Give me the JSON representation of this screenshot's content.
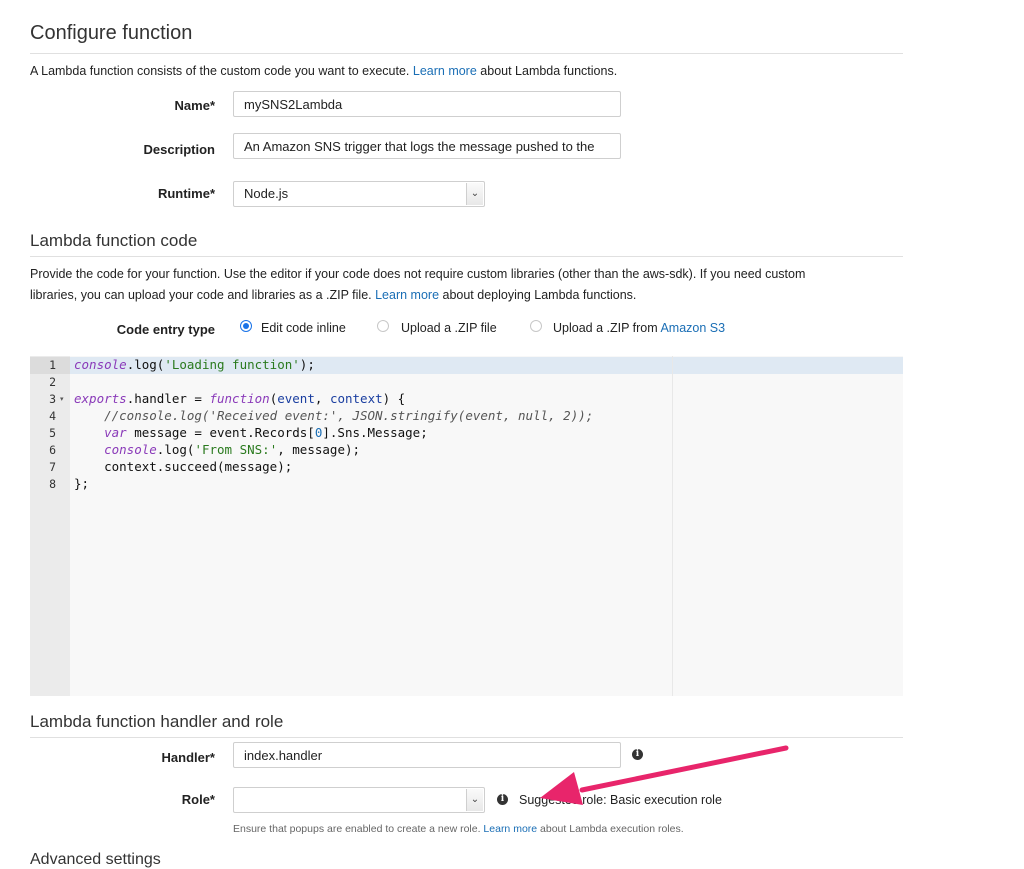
{
  "configure": {
    "title": "Configure function",
    "intro_before": "A Lambda function consists of the custom code you want to execute. ",
    "intro_link": "Learn more",
    "intro_after": " about Lambda functions.",
    "name_label": "Name*",
    "name_value": "mySNS2Lambda",
    "description_label": "Description",
    "description_value": "An Amazon SNS trigger that logs the message pushed to the",
    "runtime_label": "Runtime*",
    "runtime_value": "Node.js"
  },
  "code_section": {
    "title": "Lambda function code",
    "desc_line1": "Provide the code for your function. Use the editor if your code does not require custom libraries (other than the aws-sdk). If you need custom",
    "desc_line2_before": "libraries, you can upload your code and libraries as a .ZIP file. ",
    "desc_link": "Learn more",
    "desc_line2_after": " about deploying Lambda functions.",
    "entry_label": "Code entry type",
    "options": {
      "inline": "Edit code inline",
      "zip": "Upload a .ZIP file",
      "s3_before": "Upload a .ZIP from ",
      "s3_link": "Amazon S3"
    }
  },
  "editor": {
    "line_numbers": [
      "1",
      "2",
      "3",
      "4",
      "5",
      "6",
      "7",
      "8"
    ],
    "lines": {
      "l1_a": "console",
      "l1_b": ".log(",
      "l1_c": "'Loading function'",
      "l1_d": ");",
      "l3_a": "exports",
      "l3_b": ".handler = ",
      "l3_c": "function",
      "l3_d": "(",
      "l3_e": "event",
      "l3_f": ", ",
      "l3_g": "context",
      "l3_h": ") {",
      "l4": "    //console.log('Received event:', JSON.stringify(event, null, 2));",
      "l5_a": "    ",
      "l5_b": "var",
      "l5_c": " message = event.Records[",
      "l5_d": "0",
      "l5_e": "].Sns.Message;",
      "l6_a": "    ",
      "l6_b": "console",
      "l6_c": ".log(",
      "l6_d": "'From SNS:'",
      "l6_e": ", message);",
      "l7": "    context.succeed(message);",
      "l8": "};"
    }
  },
  "handler_section": {
    "title": "Lambda function handler and role",
    "handler_label": "Handler*",
    "handler_value": "index.handler",
    "role_label": "Role*",
    "role_value": "",
    "suggested_role": "Suggested role: Basic execution role",
    "note_before": "Ensure that popups are enabled to create a new role. ",
    "note_link": "Learn more",
    "note_after": " about Lambda execution roles."
  },
  "advanced": {
    "title": "Advanced settings"
  },
  "icons": {
    "info": "i",
    "caret": "⌄",
    "fold": "▾"
  },
  "colors": {
    "link": "#1a6eb5",
    "arrow": "#e8256b",
    "radio_selected": "#1a73e8"
  }
}
